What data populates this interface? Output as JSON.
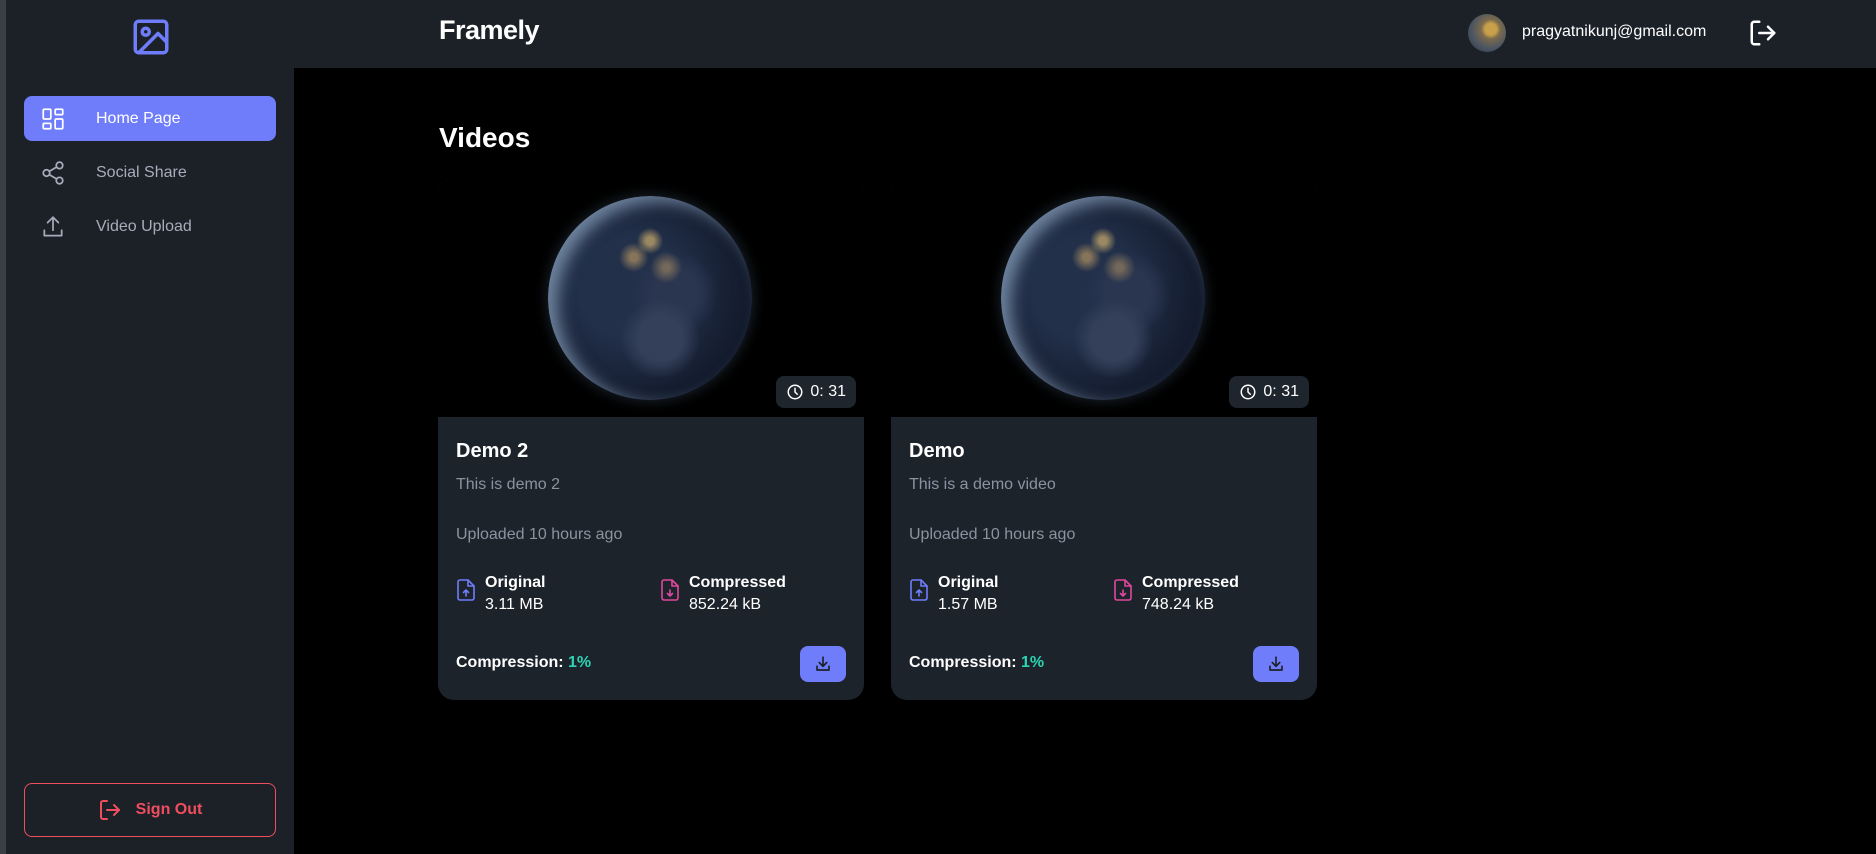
{
  "app": {
    "brand": "Framely"
  },
  "user": {
    "email": "pragyatnikunj@gmail.com"
  },
  "sidebar": {
    "items": [
      {
        "label": "Home Page",
        "icon": "dashboard-icon",
        "active": true
      },
      {
        "label": "Social Share",
        "icon": "share-icon",
        "active": false
      },
      {
        "label": "Video Upload",
        "icon": "upload-icon",
        "active": false
      }
    ],
    "sign_out_label": "Sign Out"
  },
  "main": {
    "title": "Videos",
    "videos": [
      {
        "title": "Demo 2",
        "description": "This is demo 2",
        "uploaded": "Uploaded 10 hours ago",
        "duration": "0: 31",
        "original_label": "Original",
        "original_size": "3.11 MB",
        "compressed_label": "Compressed",
        "compressed_size": "852.24 kB",
        "compression_label": "Compression:",
        "compression_value": "1%"
      },
      {
        "title": "Demo",
        "description": "This is a demo video",
        "uploaded": "Uploaded 10 hours ago",
        "duration": "0: 31",
        "original_label": "Original",
        "original_size": "1.57 MB",
        "compressed_label": "Compressed",
        "compressed_size": "748.24 kB",
        "compression_label": "Compression:",
        "compression_value": "1%"
      }
    ]
  },
  "colors": {
    "accent": "#6f7dfb",
    "danger": "#f04e5e",
    "success": "#2bd4b4",
    "compressed_icon": "#e0479e",
    "panel": "#1c2128",
    "background": "#000000"
  }
}
